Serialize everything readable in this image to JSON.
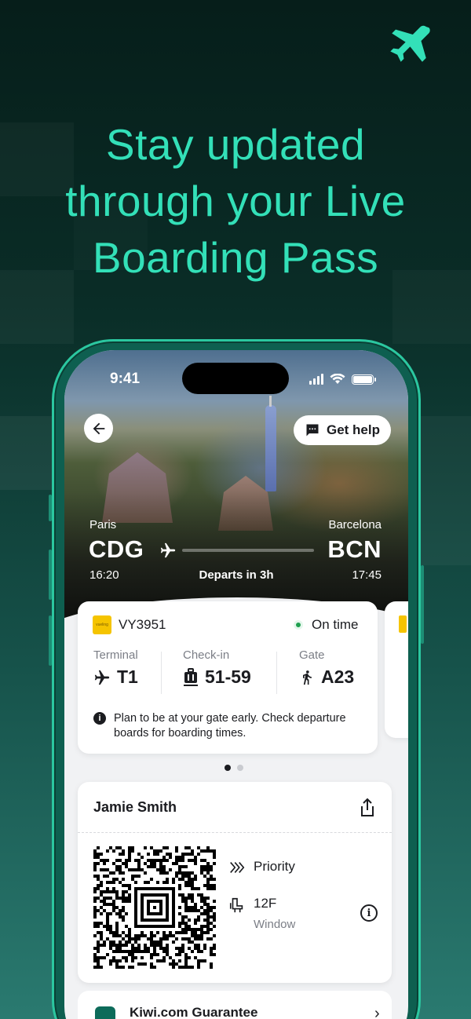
{
  "colors": {
    "accent": "#33e0b8",
    "on_time": "#1fa04f",
    "airline": "#f5c400"
  },
  "promo": {
    "headline_lines": [
      "Stay updated",
      "through your Live",
      "Boarding Pass"
    ],
    "logo_icon": "plane-icon"
  },
  "status_bar": {
    "time": "9:41"
  },
  "header": {
    "get_help_label": "Get help"
  },
  "route": {
    "origin_city": "Paris",
    "origin_code": "CDG",
    "departure_time": "16:20",
    "destination_city": "Barcelona",
    "destination_code": "BCN",
    "arrival_time": "17:45",
    "departs_label": "Departs in 3h"
  },
  "flight_card": {
    "airline_logo_text": "vueling",
    "flight_number": "VY3951",
    "status": "On time",
    "terminal": {
      "label": "Terminal",
      "value": "T1",
      "icon": "plane-icon"
    },
    "checkin": {
      "label": "Check-in",
      "value": "51-59",
      "icon": "luggage-icon"
    },
    "gate": {
      "label": "Gate",
      "value": "A23",
      "icon": "walking-icon"
    },
    "notice": "Plan to be at your gate early. Check departure boards for boarding times."
  },
  "pager": {
    "count": 2,
    "active": 0
  },
  "boarding_pass": {
    "passenger": "Jamie Smith",
    "priority_label": "Priority",
    "seat": "12F",
    "seat_type": "Window"
  },
  "guarantee": {
    "label": "Kiwi.com Guarantee"
  }
}
